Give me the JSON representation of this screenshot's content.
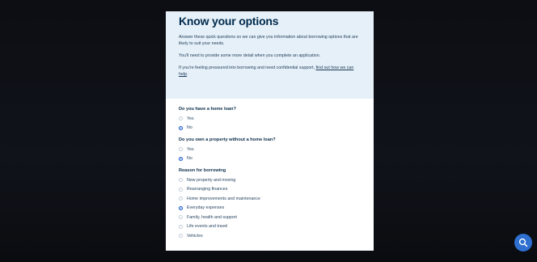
{
  "page": {
    "title": "Know your options",
    "intro": [
      "Answer these quick questions so we can give you information about borrowing options that are likely to suit your needs.",
      "You'll need to provide some more detail when you complete an application."
    ],
    "support_prefix": "If you're feeling pressured into borrowing and need confidential support,",
    "support_link": "find out how we can help",
    "support_suffix": "."
  },
  "questions": {
    "home_loan": {
      "label": "Do you have a home loan?",
      "options": [
        "Yes",
        "No"
      ],
      "selected": "No"
    },
    "property": {
      "label": "Do you own a property without a home loan?",
      "options": [
        "Yes",
        "No"
      ],
      "selected": "No"
    },
    "reason": {
      "label": "Reason for borrowing",
      "options": [
        "New property and moving",
        "Rearranging finances",
        "Home improvements and maintenance",
        "Everyday expenses",
        "Family, health and support",
        "Life events and travel",
        "Vehicles"
      ],
      "selected": "Everyday expenses"
    }
  },
  "ui": {
    "search_icon": "search-icon",
    "accent_color": "#1559c9",
    "header_bg": "#e6f0f8",
    "title_color": "#002a4d"
  }
}
